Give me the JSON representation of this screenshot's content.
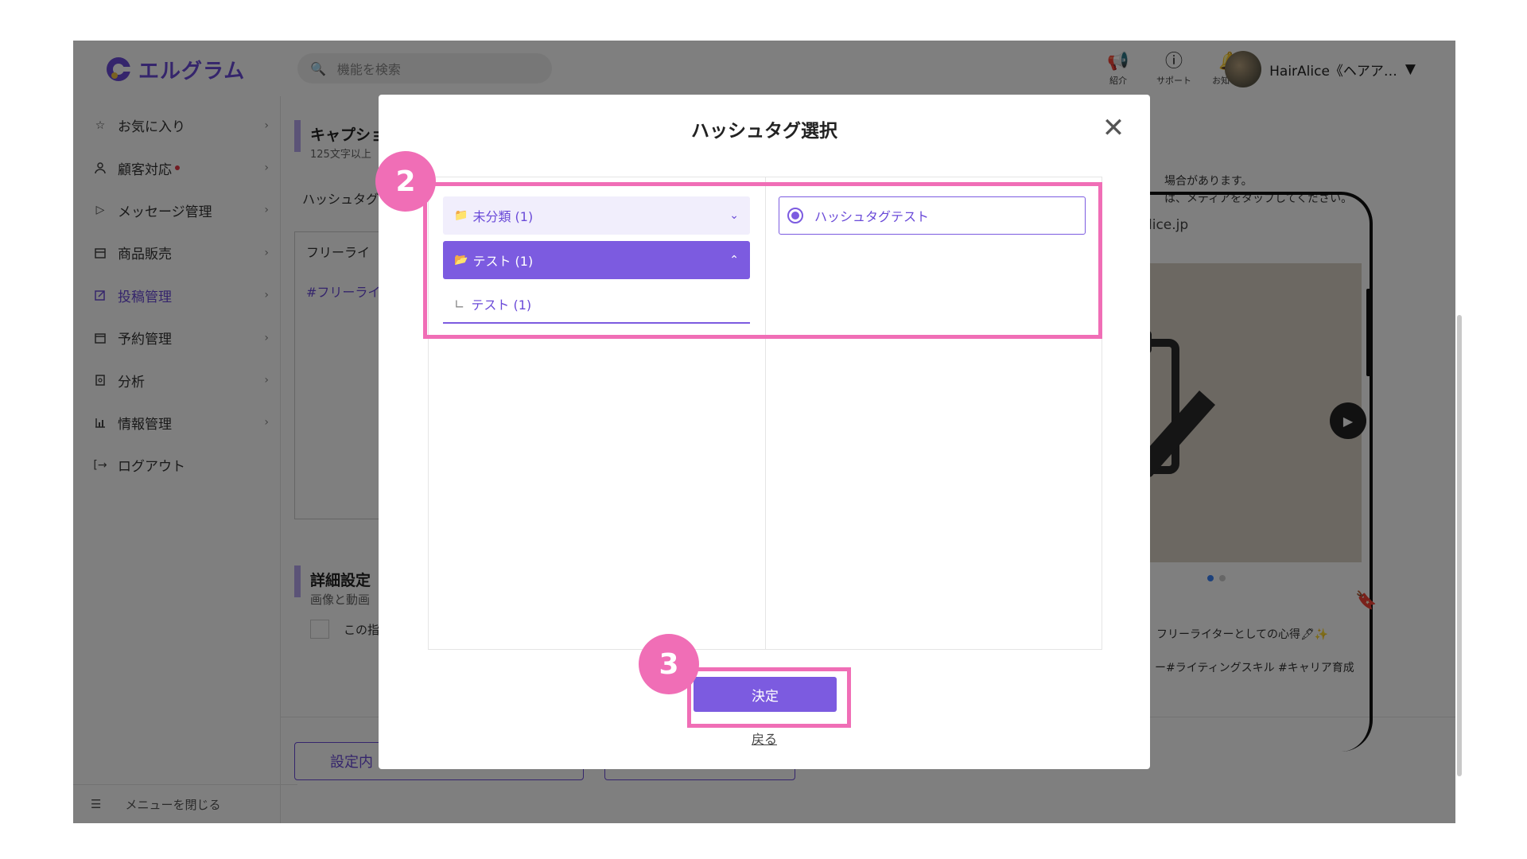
{
  "app": {
    "logo_text": "エルグラム",
    "brand_color": "#6a4ad8"
  },
  "sidebar": {
    "items": [
      {
        "label": "お気に入り",
        "icon": "star-icon"
      },
      {
        "label": "顧客対応",
        "icon": "user-icon",
        "badge": true
      },
      {
        "label": "メッセージ管理",
        "icon": "send-icon"
      },
      {
        "label": "商品販売",
        "icon": "store-icon"
      },
      {
        "label": "投稿管理",
        "icon": "edit-icon",
        "active": true
      },
      {
        "label": "予約管理",
        "icon": "calendar-icon"
      },
      {
        "label": "分析",
        "icon": "report-icon"
      },
      {
        "label": "情報管理",
        "icon": "chart-icon"
      },
      {
        "label": "ログアウト",
        "icon": "logout-icon"
      }
    ],
    "footer_label": "メニューを閉じる"
  },
  "header": {
    "search_placeholder": "機能を検索",
    "icons": [
      {
        "label": "紹介",
        "icon": "megaphone-icon"
      },
      {
        "label": "サポート",
        "icon": "help-icon"
      },
      {
        "label": "お知らせ",
        "icon": "bell-icon"
      }
    ],
    "account_name": "HairAlice《ヘアア…"
  },
  "background": {
    "caption_title": "キャプショ",
    "caption_sub": "125文字以上",
    "hashtag_label": "ハッシュタグ",
    "freewriter_label": "フリーライ",
    "freewriter_tag": "#フリーライ",
    "detail_title": "詳細設定",
    "detail_sub": "画像と動画",
    "checkbox_label": "この指",
    "setting_btn": "設定内",
    "note_line1": "場合があります。",
    "note_line2": "は、メディアをタップしてください。",
    "phone_url": "lice.jp",
    "phone_caption": "フリーライターとしての心得🖋✨",
    "phone_tags": "ー#ライティングスキル #キャリア育成"
  },
  "modal": {
    "title": "ハッシュタグ選択",
    "categories": [
      {
        "label": "未分類 (1)",
        "state": "collapsed"
      },
      {
        "label": "テスト (1)",
        "state": "expanded"
      }
    ],
    "subcategory": "テスト (1)",
    "hashtags": [
      {
        "label": "ハッシュタグテスト",
        "selected": true
      }
    ],
    "confirm_label": "決定",
    "back_label": "戻る"
  },
  "annotations": {
    "step2": "2",
    "step3": "3",
    "color": "#f06eb6"
  }
}
